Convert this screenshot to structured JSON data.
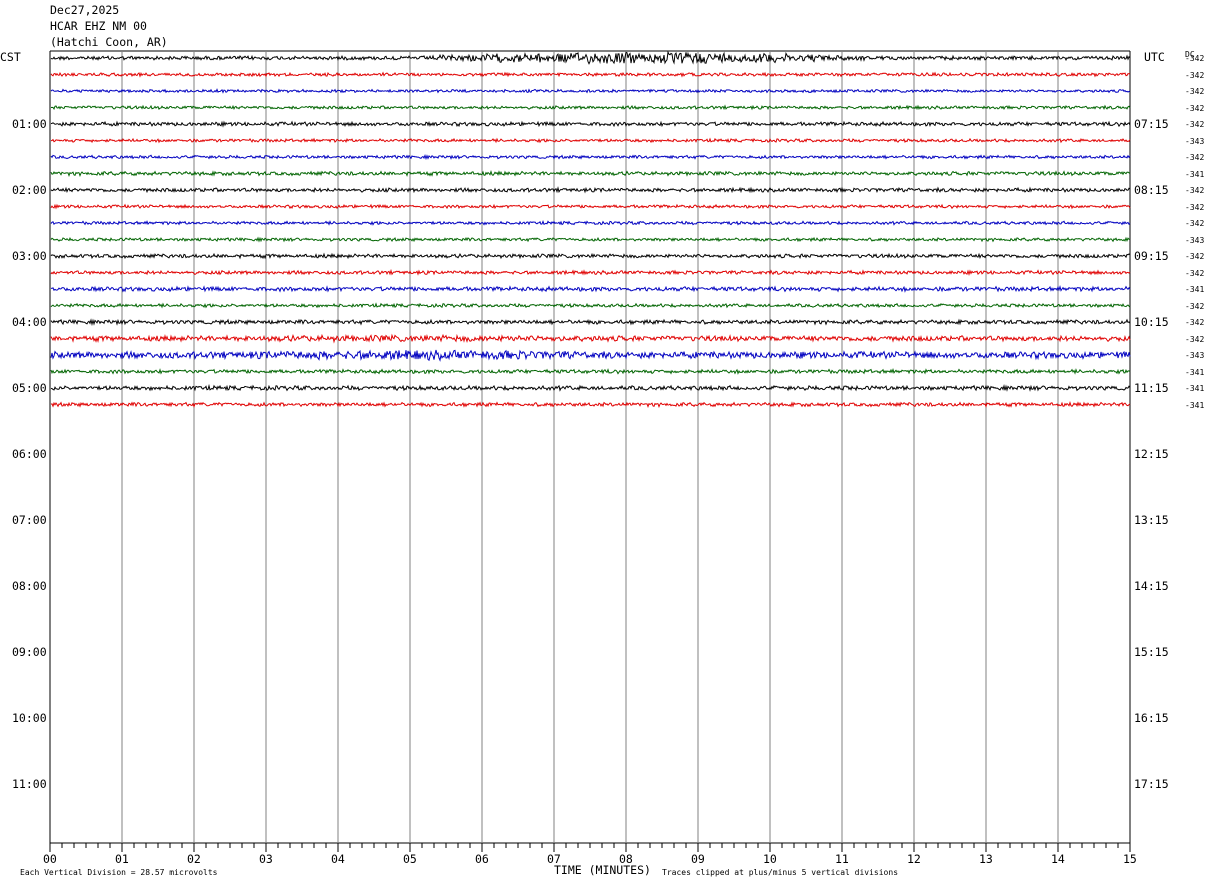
{
  "header": {
    "date": "Dec27,2025",
    "station": "HCAR EHZ NM 00",
    "location": "(Hatchi Coon, AR)"
  },
  "left_tz": "CST",
  "right_tz": "UTC",
  "dc_label": "DC",
  "footer": {
    "left_note": "Each Vertical Division =   28.57 microvolts",
    "xlabel": "TIME (MINUTES)",
    "right_note": "Traces clipped at plus/minus 5 vertical divisions"
  },
  "chart_data": {
    "type": "line",
    "title": "HCAR EHZ NM 00 (Hatchi Coon, AR)",
    "xlabel": "TIME (MINUTES)",
    "xlim": [
      0,
      15
    ],
    "x_ticks": [
      "00",
      "01",
      "02",
      "03",
      "04",
      "05",
      "06",
      "07",
      "08",
      "09",
      "10",
      "11",
      "12",
      "13",
      "14",
      "15"
    ],
    "left_hour_labels": [
      "01:00",
      "02:00",
      "03:00",
      "04:00",
      "05:00",
      "06:00",
      "07:00",
      "08:00",
      "09:00",
      "10:00",
      "11:00"
    ],
    "right_hour_labels": [
      "07:15",
      "08:15",
      "09:15",
      "10:15",
      "11:15",
      "12:15",
      "13:15",
      "14:15",
      "15:15",
      "16:15",
      "17:15"
    ],
    "trace_colors": [
      "#000000",
      "#e00000",
      "#0000c0",
      "#006400"
    ],
    "rows_per_hour": 4,
    "total_rows": 48,
    "trace_rows": [
      {
        "dc": "-342",
        "amplitude": 1.6,
        "event": {
          "start": 5.0,
          "end": 12.5,
          "amp": 5.0
        }
      },
      {
        "dc": "-342",
        "amplitude": 1.4
      },
      {
        "dc": "-342",
        "amplitude": 1.2
      },
      {
        "dc": "-342",
        "amplitude": 1.3
      },
      {
        "dc": "-342",
        "amplitude": 1.6
      },
      {
        "dc": "-343",
        "amplitude": 1.3
      },
      {
        "dc": "-342",
        "amplitude": 1.3
      },
      {
        "dc": "-341",
        "amplitude": 1.6
      },
      {
        "dc": "-342",
        "amplitude": 1.6
      },
      {
        "dc": "-342",
        "amplitude": 1.3
      },
      {
        "dc": "-342",
        "amplitude": 1.3
      },
      {
        "dc": "-343",
        "amplitude": 1.3
      },
      {
        "dc": "-342",
        "amplitude": 1.6
      },
      {
        "dc": "-342",
        "amplitude": 1.5
      },
      {
        "dc": "-341",
        "amplitude": 1.8
      },
      {
        "dc": "-342",
        "amplitude": 1.4
      },
      {
        "dc": "-342",
        "amplitude": 1.7
      },
      {
        "dc": "-342",
        "amplitude": 2.2,
        "event": {
          "start": 2.3,
          "end": 9.0,
          "amp": 2.8
        }
      },
      {
        "dc": "-343",
        "amplitude": 2.8,
        "event": {
          "start": 2.5,
          "end": 8.5,
          "amp": 4.2
        }
      },
      {
        "dc": "-341",
        "amplitude": 1.6
      },
      {
        "dc": "-341",
        "amplitude": 1.8
      },
      {
        "dc": "-341",
        "amplitude": 1.6
      }
    ]
  }
}
